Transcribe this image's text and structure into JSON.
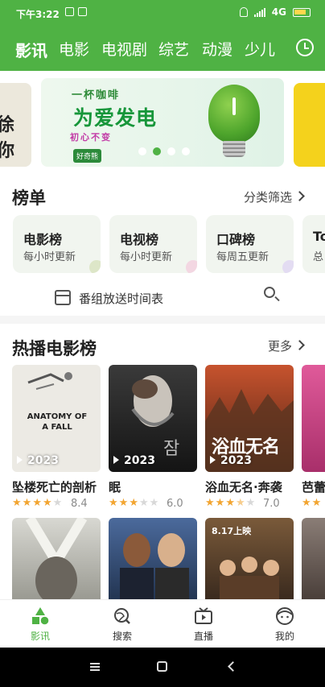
{
  "status_bar": {
    "time": "下午3:22",
    "network": "4G"
  },
  "top_tabs": [
    "影讯",
    "电影",
    "电视剧",
    "综艺",
    "动漫",
    "少儿"
  ],
  "banner": {
    "left_peek_text": "徐你",
    "tagline": "一杯咖啡",
    "title": "为爱发电",
    "subtitle": "初心不变",
    "brand": "好奇熊",
    "dot_count": 4,
    "active_dot": 1
  },
  "rankings": {
    "title": "榜单",
    "filter_label": "分类筛选",
    "cards": [
      {
        "title": "电影榜",
        "subtitle": "每小时更新"
      },
      {
        "title": "电视榜",
        "subtitle": "每小时更新"
      },
      {
        "title": "口碑榜",
        "subtitle": "每周五更新"
      },
      {
        "title": "To",
        "subtitle": "总"
      }
    ],
    "schedule_label": "番组放送时间表"
  },
  "hot_movies": {
    "title": "热播电影榜",
    "more_label": "更多",
    "movies": [
      {
        "title": "坠楼死亡的剖析",
        "year": "2023",
        "score": "8.4",
        "stars": 4,
        "poster_text": "ANATOMY OF A FALL"
      },
      {
        "title": "眠",
        "year": "2023",
        "score": "6.0",
        "stars": 3,
        "poster_text": "잠"
      },
      {
        "title": "浴血无名·奔袭",
        "year": "2023",
        "score": "7.0",
        "stars": 3.5,
        "poster_text": "浴血无名"
      },
      {
        "title": "芭蕾",
        "year": "",
        "score": "",
        "stars": 2,
        "poster_text": ""
      }
    ],
    "second_row_posters": [
      "",
      "",
      "8.17上映",
      ""
    ]
  },
  "bottom_nav": [
    {
      "label": "影讯",
      "icon": "shapes-icon",
      "active": true
    },
    {
      "label": "搜索",
      "icon": "search-globe-icon",
      "active": false
    },
    {
      "label": "直播",
      "icon": "tv-icon",
      "active": false
    },
    {
      "label": "我的",
      "icon": "face-icon",
      "active": false
    }
  ],
  "colors": {
    "brand_green": "#4fb244",
    "star": "#f2a531"
  }
}
